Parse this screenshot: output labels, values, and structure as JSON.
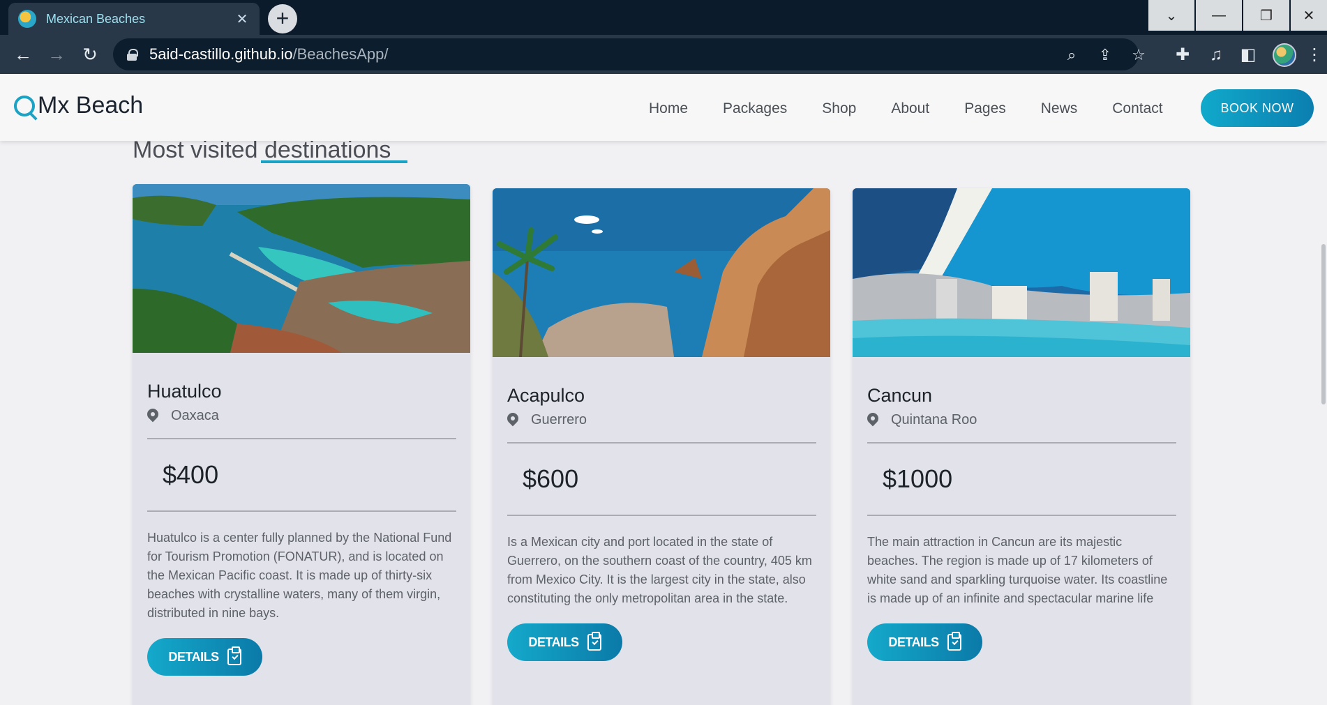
{
  "browser": {
    "tab_title": "Mexican Beaches",
    "tab_close": "✕",
    "new_tab": "+",
    "url_host": "5aid-castillo.github.io",
    "url_path": "/BeachesApp/",
    "window_controls": {
      "dropdown": "⌄",
      "minimize": "—",
      "restore": "❐",
      "close": "✕"
    },
    "nav": {
      "back": "←",
      "forward": "→",
      "reload": "↻"
    }
  },
  "site": {
    "logo_text": "Mx Beach",
    "menu": [
      "Home",
      "Packages",
      "Shop",
      "About",
      "Pages",
      "News",
      "Contact"
    ],
    "book_now": "BOOK NOW"
  },
  "section": {
    "title": "Most visited destinations"
  },
  "cards": [
    {
      "name": "Huatulco",
      "location": "Oaxaca",
      "price": "$400",
      "description": "Huatulco is a center fully planned by the National Fund for Tourism Promotion (FONATUR), and is located on the Mexican Pacific coast. It is made up of thirty-six beaches with crystalline waters, many of them virgin, distributed in nine bays.",
      "button": "DETAILS"
    },
    {
      "name": "Acapulco",
      "location": "Guerrero",
      "price": "$600",
      "description": "Is a Mexican city and port located in the state of Guerrero, on the southern coast of the country, 405 km from Mexico City. It is the largest city in the state, also constituting the only metropolitan area in the state.",
      "button": "DETAILS"
    },
    {
      "name": "Cancun",
      "location": "Quintana Roo",
      "price": "$1000",
      "description": "The main attraction in Cancun are its majestic beaches. The region is made up of 17 kilometers of white sand and sparkling turquoise water. Its coastline is made up of an infinite and spectacular marine life",
      "button": "DETAILS"
    }
  ],
  "colors": {
    "accent": "#1aa3c4",
    "chrome_dark": "#0b1b2b",
    "chrome_bar": "#283848"
  }
}
